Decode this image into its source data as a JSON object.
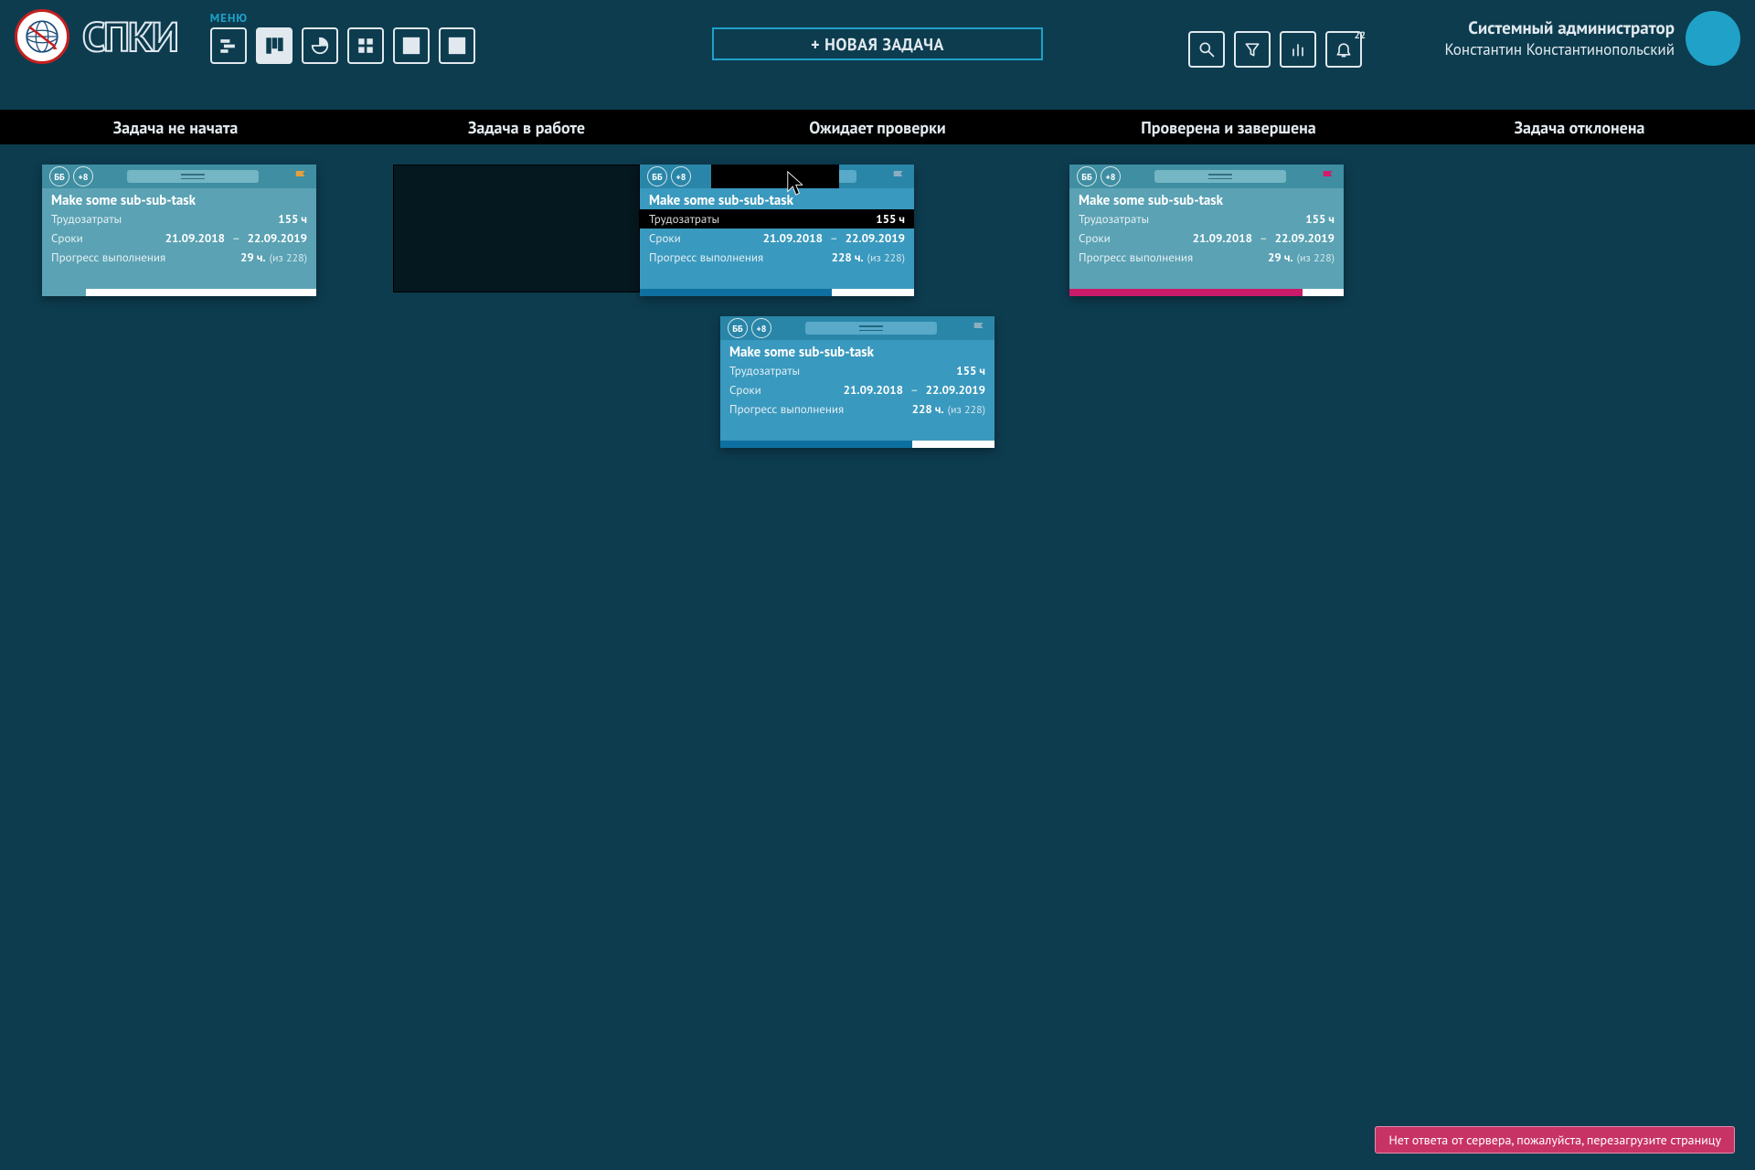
{
  "header": {
    "menu_label": "МЕНЮ",
    "logo_text": "СПКИ",
    "new_task": "+ НОВАЯ ЗАДАЧА",
    "bell_count": "22",
    "user_role": "Системный администратор",
    "user_name": "Константин Константинопольский"
  },
  "columns": [
    "Задача не начата",
    "Задача в работе",
    "Ожидает проверки",
    "Проверена и завершена",
    "Задача отклонена"
  ],
  "card_labels": {
    "effort": "Трудозатраты",
    "dates": "Сроки",
    "progress": "Прогресс выполнения"
  },
  "cards": {
    "c1": {
      "chip1": "ББ",
      "chip2": "+8",
      "title": "Make some sub-sub-task",
      "effort": "155 ч",
      "d1": "21.09.2018",
      "d2": "22.09.2019",
      "prog_val": "29 ч.",
      "prog_of": "(из 228)",
      "flag": "#e6a03a",
      "bar_w": "16%"
    },
    "c2": {
      "chip1": "ББ",
      "chip2": "+8",
      "title": "Make some sub-sub-task",
      "effort": "155 ч",
      "d1": "21.09.2018",
      "d2": "22.09.2019",
      "prog_val": "228 ч.",
      "prog_of": "(из 228)",
      "flag": "#8baec0",
      "bar_w": "70%"
    },
    "c3": {
      "chip1": "ББ",
      "chip2": "+8",
      "title": "Make some sub-sub-task",
      "effort": "155 ч",
      "d1": "21.09.2018",
      "d2": "22.09.2019",
      "prog_val": "228 ч.",
      "prog_of": "(из 228)",
      "flag": "#8baec0",
      "bar_w": "70%"
    },
    "c4": {
      "chip1": "ББ",
      "chip2": "+8",
      "title": "Make some sub-sub-task",
      "effort": "155 ч",
      "d1": "21.09.2018",
      "d2": "22.09.2019",
      "prog_val": "29 ч.",
      "prog_of": "(из 228)",
      "flag": "#d31b6c",
      "bar_w": "85%"
    }
  },
  "toast": "Нет ответа от сервера, пожалуйста, перезагрузите страницу"
}
